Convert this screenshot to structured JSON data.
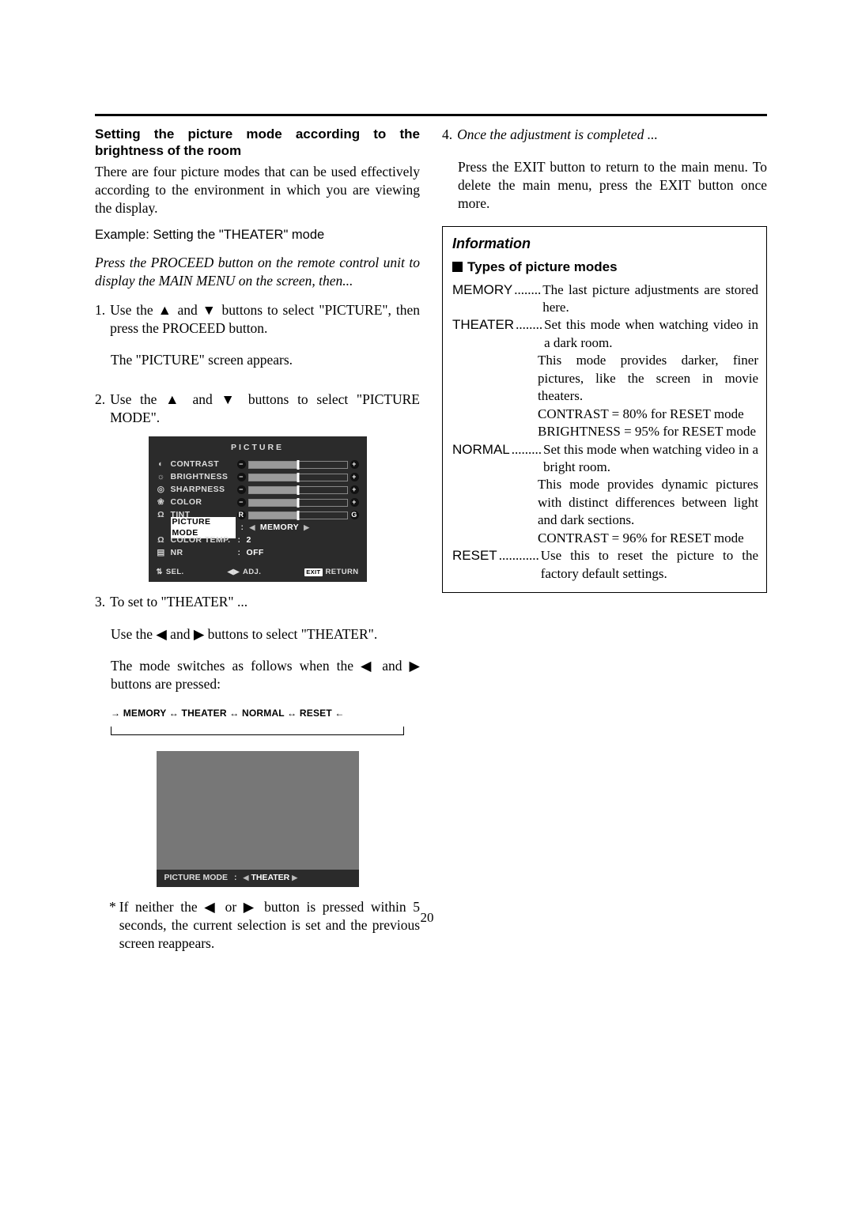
{
  "left": {
    "title": "Setting the picture mode according to the brightness of the room",
    "intro": "There are four picture modes that can be used effectively according to the environment in which you are viewing the display.",
    "example": "Example: Setting the \"THEATER\" mode",
    "preamble": "Press the PROCEED button on the remote control unit to display the MAIN MENU on the screen, then...",
    "step1": {
      "n": "1.",
      "text": "Use the ▲ and ▼ buttons to select \"PICTURE\", then press the PROCEED button.",
      "after": "The \"PICTURE\" screen appears."
    },
    "step2": {
      "n": "2.",
      "text": "Use the ▲ and ▼ buttons to select \"PICTURE MODE\"."
    },
    "step3": {
      "n": "3.",
      "text": "To set to \"THEATER\" ...",
      "line1": "Use the ◀ and ▶ buttons to select \"THEATER\".",
      "line2": "The mode switches as follows when the ◀ and ▶ buttons are pressed:"
    },
    "cycle": "→ MEMORY ↔ THEATER ↔ NORMAL ↔ RESET ←",
    "note": "If neither the ◀ or ▶ button is pressed within 5 seconds, the current selection is set and the previous screen reappears.",
    "noteMark": "*"
  },
  "osd": {
    "title": "PICTURE",
    "rows": {
      "contrast": "CONTRAST",
      "brightness": "BRIGHTNESS",
      "sharpness": "SHARPNESS",
      "color": "COLOR",
      "tint": "TINT",
      "picmode_label": "PICTURE MODE",
      "picmode_value": "MEMORY",
      "colortemp_label": "COLOR TEMP.",
      "colortemp_value": "2",
      "nr_label": "NR",
      "nr_value": "OFF"
    },
    "footer": {
      "sel": "SEL.",
      "adj": "ADJ.",
      "exit": "EXIT",
      "ret": "RETURN"
    }
  },
  "osd2": {
    "label": "PICTURE MODE",
    "value": "THEATER"
  },
  "right": {
    "step4": {
      "n": "4.",
      "title": "Once the adjustment is completed ...",
      "body": "Press the EXIT button to return to the main menu. To delete the main menu, press the EXIT button once more."
    },
    "info": {
      "heading": "Information",
      "sub": "Types of picture modes",
      "items": [
        {
          "term": "MEMORY",
          "dots": "........",
          "def": "The last picture adjustments are stored here."
        },
        {
          "term": "THEATER",
          "dots": "........",
          "def": "Set this mode when watching video in a dark room.",
          "cont": [
            "This mode provides darker, finer pictures, like the screen in movie theaters.",
            "CONTRAST = 80% for RESET mode",
            "BRIGHTNESS = 95% for RESET mode"
          ]
        },
        {
          "term": "NORMAL",
          "dots": ".........",
          "def": "Set this mode when watching video in a bright room.",
          "cont": [
            "This mode provides dynamic pictures with distinct differences between light and dark sections.",
            "CONTRAST = 96% for RESET mode"
          ]
        },
        {
          "term": "RESET",
          "dots": "............",
          "def": "Use this to reset the picture to the factory default settings."
        }
      ]
    }
  },
  "pagenum": "20"
}
